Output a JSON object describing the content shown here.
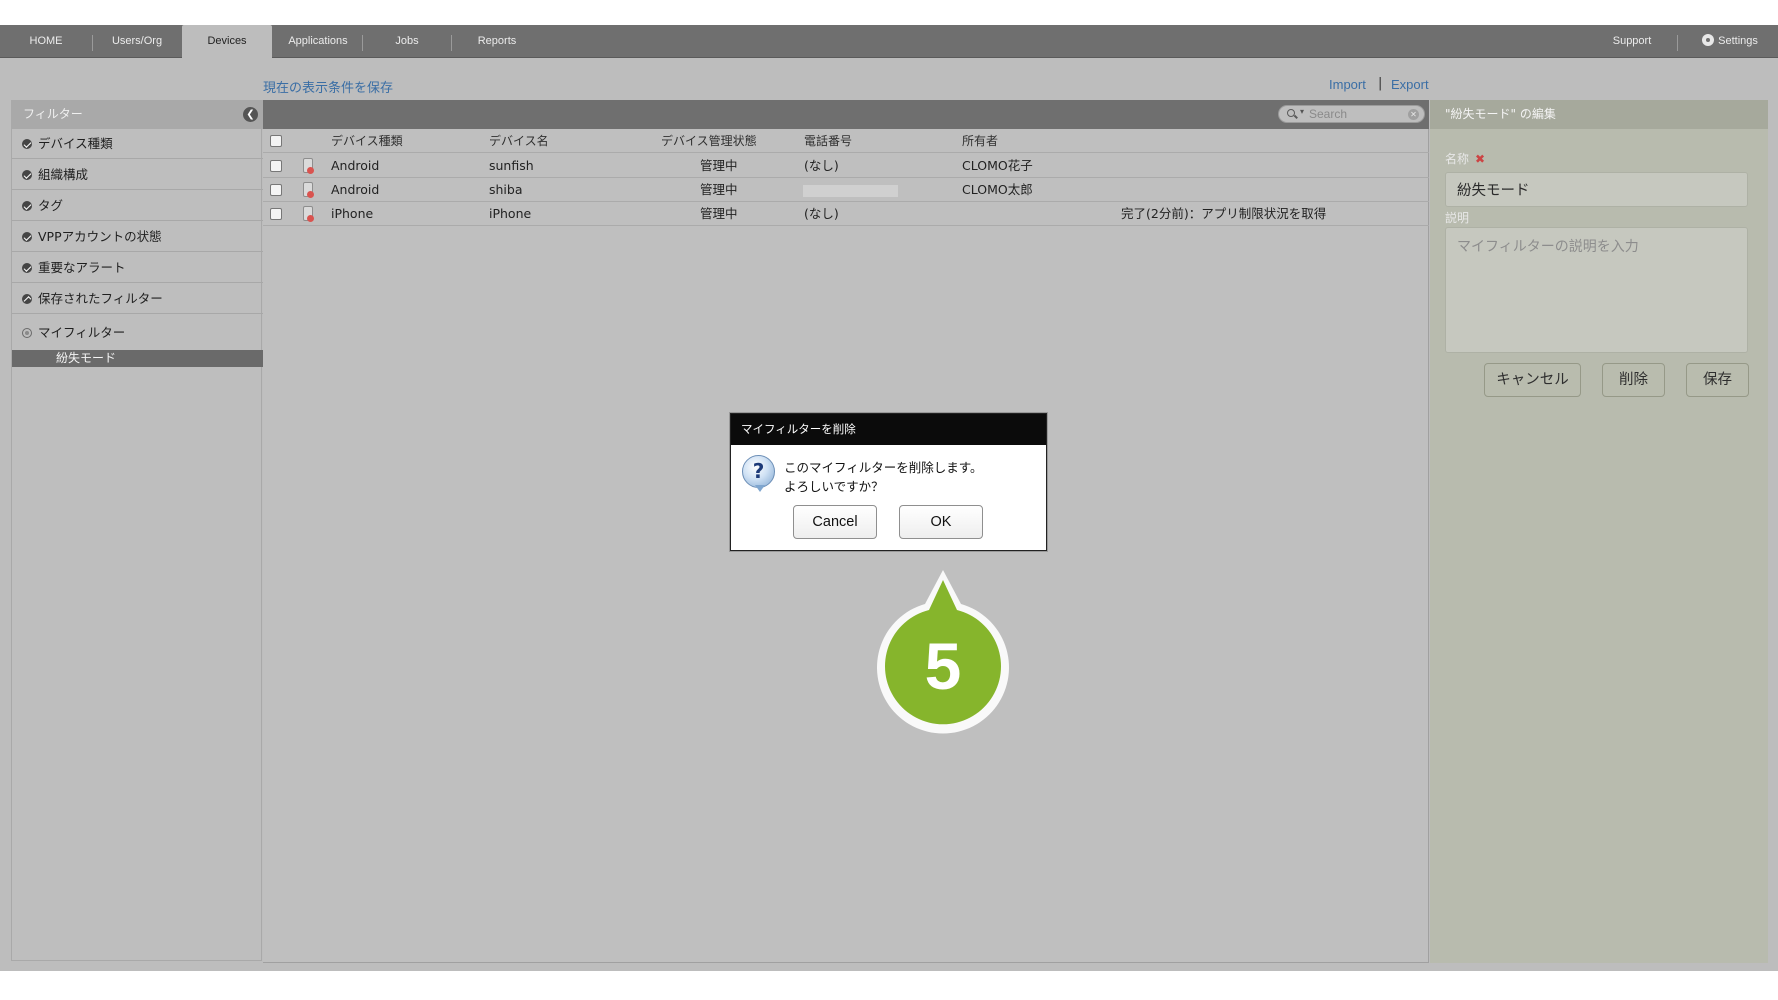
{
  "nav": {
    "tabs": [
      {
        "label": "HOME"
      },
      {
        "label": "Users/Org"
      },
      {
        "label": "Devices"
      },
      {
        "label": "Applications"
      },
      {
        "label": "Jobs"
      },
      {
        "label": "Reports"
      }
    ],
    "support": "Support",
    "settings": "Settings"
  },
  "toolbar": {
    "save_view": "現在の表示条件を保存",
    "import": "Import",
    "separator": "|",
    "export": "Export"
  },
  "sidebar": {
    "title": "フィルター",
    "items": [
      {
        "label": "デバイス種類"
      },
      {
        "label": "組織構成"
      },
      {
        "label": "タグ"
      },
      {
        "label": "VPPアカウントの状態"
      },
      {
        "label": "重要なアラート"
      },
      {
        "label": "保存されたフィルター"
      }
    ],
    "my_filters": {
      "label": "マイフィルター",
      "selected": "紛失モード"
    }
  },
  "search": {
    "placeholder": "Search"
  },
  "table": {
    "columns": [
      "デバイス種類",
      "デバイス名",
      "デバイス管理状態",
      "電話番号",
      "所有者"
    ],
    "rows": [
      {
        "type": "Android",
        "name": "sunfish",
        "status": "管理中",
        "phone": "(なし)",
        "owner": "CLOMO花子",
        "note": ""
      },
      {
        "type": "Android",
        "name": "shiba",
        "status": "管理中",
        "phone": "",
        "owner": "CLOMO太郎",
        "note": ""
      },
      {
        "type": "iPhone",
        "name": "iPhone",
        "status": "管理中",
        "phone": "(なし)",
        "owner": "",
        "note": "完了(2分前)：アプリ制限状況を取得"
      }
    ]
  },
  "edit_panel": {
    "title": "\"紛失モード\" の編集",
    "name_label": "名称",
    "required_mark": "✖",
    "name_value": "紛失モード",
    "desc_label": "説明",
    "desc_placeholder": "マイフィルターの説明を入力",
    "cancel": "キャンセル",
    "delete": "削除",
    "save": "保存"
  },
  "dialog": {
    "title": "マイフィルターを削除",
    "line1": "このマイフィルターを削除します。",
    "line2": "よろしいですか？",
    "icon": "?",
    "cancel": "Cancel",
    "ok": "OK"
  },
  "callout": {
    "step": "5",
    "color": "#86b52c"
  }
}
